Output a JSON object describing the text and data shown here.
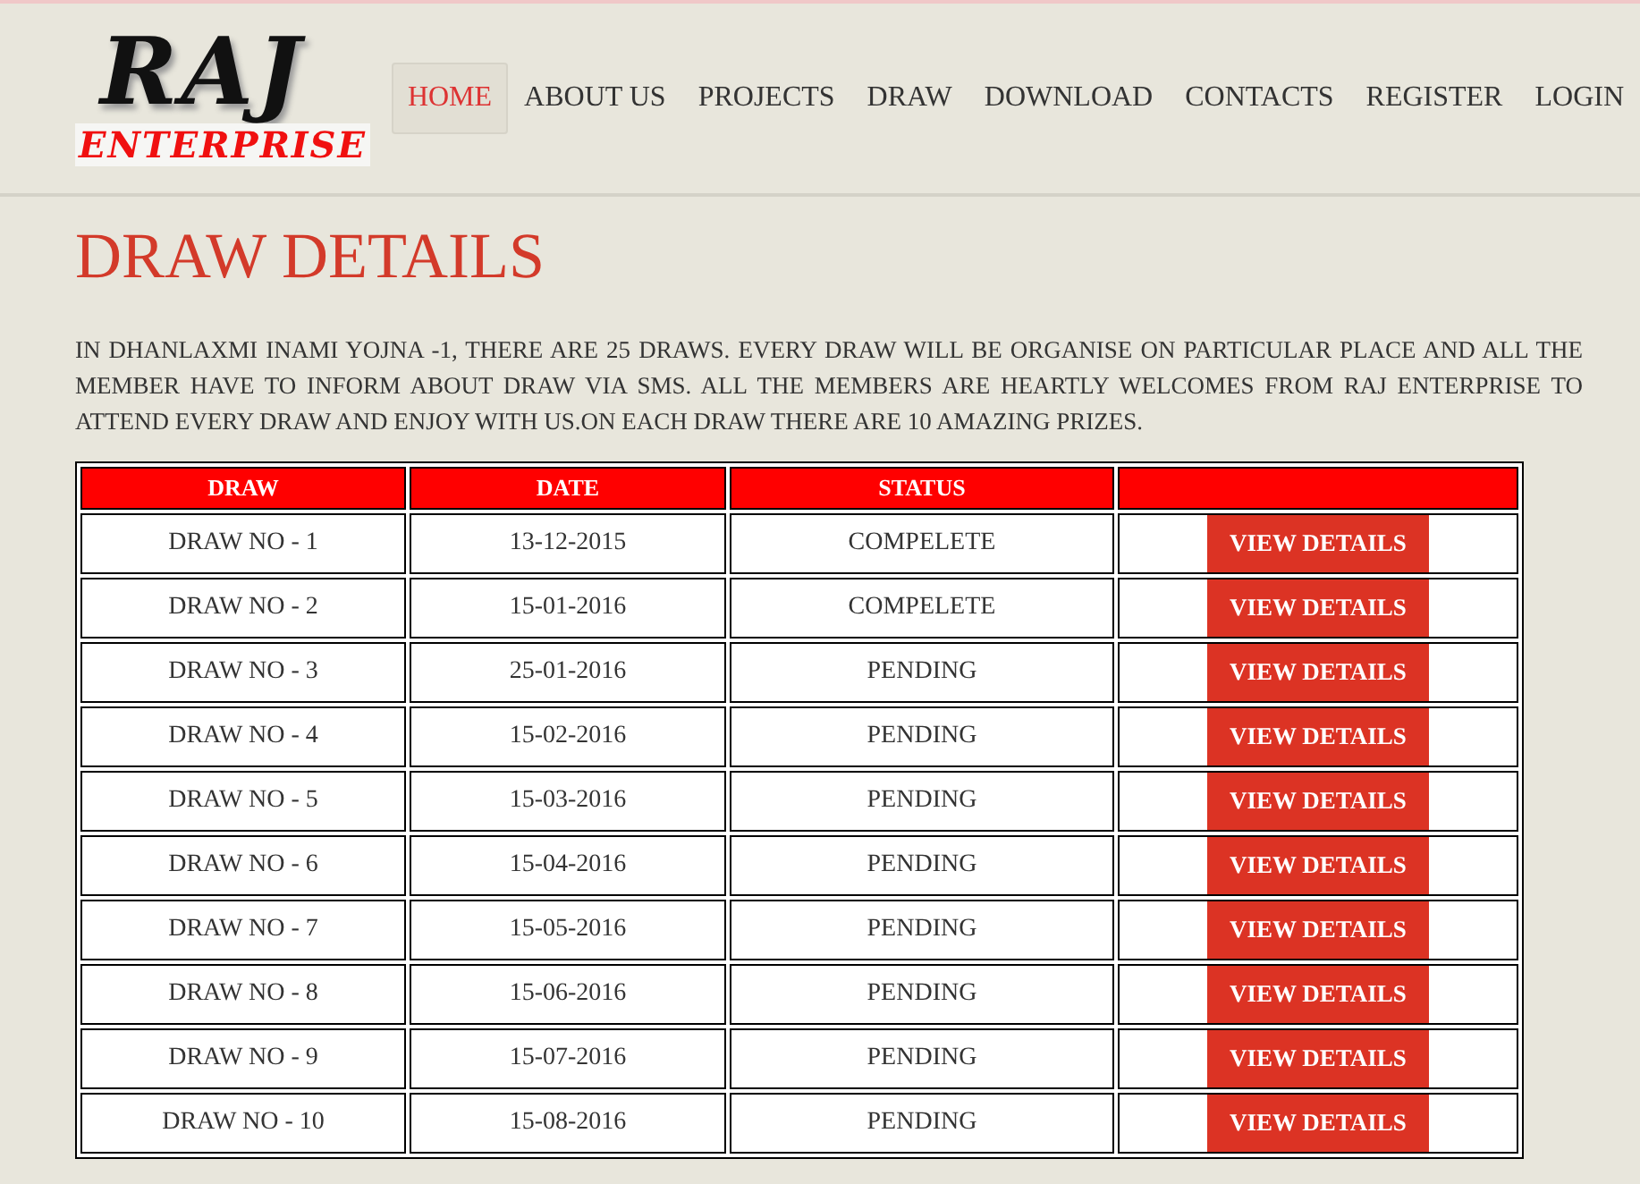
{
  "logo": {
    "title": "RAJ",
    "subtitle": "ENTERPRISE"
  },
  "nav": [
    {
      "label": "HOME",
      "selected": true
    },
    {
      "label": "ABOUT US",
      "selected": false
    },
    {
      "label": "PROJECTS",
      "selected": false
    },
    {
      "label": "DRAW",
      "selected": false
    },
    {
      "label": "DOWNLOAD",
      "selected": false
    },
    {
      "label": "CONTACTS",
      "selected": false
    },
    {
      "label": "REGISTER",
      "selected": false
    },
    {
      "label": "LOGIN",
      "selected": false
    }
  ],
  "heading": "DRAW DETAILS",
  "intro": "IN DHANLAXMI INAMI YOJNA -1, THERE ARE 25 DRAWS. EVERY DRAW WILL BE ORGANISE ON PARTICULAR PLACE AND ALL THE MEMBER HAVE TO INFORM ABOUT DRAW VIA SMS. ALL THE MEMBERS ARE HEARTLY WELCOMES FROM RAJ ENTERPRISE TO ATTEND EVERY DRAW AND ENJOY WITH US.ON EACH DRAW THERE ARE 10 AMAZING PRIZES.",
  "table": {
    "columns": [
      "DRAW",
      "DATE",
      "STATUS"
    ],
    "rows": [
      {
        "draw": "DRAW NO - 1",
        "date": "13-12-2015",
        "status": "COMPELETE",
        "action": "VIEW DETAILS"
      },
      {
        "draw": "DRAW NO - 2",
        "date": "15-01-2016",
        "status": "COMPELETE",
        "action": "VIEW DETAILS"
      },
      {
        "draw": "DRAW NO - 3",
        "date": "25-01-2016",
        "status": "PENDING",
        "action": "VIEW DETAILS"
      },
      {
        "draw": "DRAW NO - 4",
        "date": "15-02-2016",
        "status": "PENDING",
        "action": "VIEW DETAILS"
      },
      {
        "draw": "DRAW NO - 5",
        "date": "15-03-2016",
        "status": "PENDING",
        "action": "VIEW DETAILS"
      },
      {
        "draw": "DRAW NO - 6",
        "date": "15-04-2016",
        "status": "PENDING",
        "action": "VIEW DETAILS"
      },
      {
        "draw": "DRAW NO - 7",
        "date": "15-05-2016",
        "status": "PENDING",
        "action": "VIEW DETAILS"
      },
      {
        "draw": "DRAW NO - 8",
        "date": "15-06-2016",
        "status": "PENDING",
        "action": "VIEW DETAILS"
      },
      {
        "draw": "DRAW NO - 9",
        "date": "15-07-2016",
        "status": "PENDING",
        "action": "VIEW DETAILS"
      },
      {
        "draw": "DRAW NO - 10",
        "date": "15-08-2016",
        "status": "PENDING",
        "action": "VIEW DETAILS"
      }
    ]
  }
}
